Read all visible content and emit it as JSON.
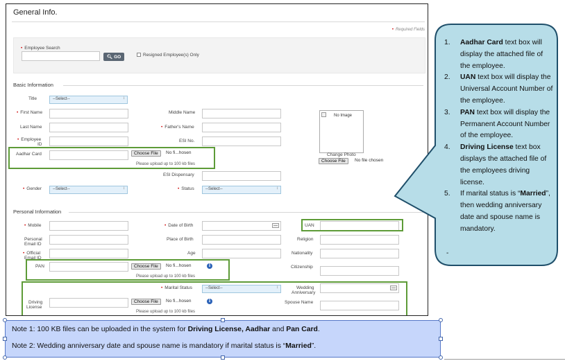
{
  "form": {
    "title": "General Info.",
    "required_note": "Required Fields",
    "search": {
      "employee_search_label": "Employee Search",
      "go_label": "GO",
      "resigned_label": "Resigned Employee(s) Only"
    },
    "basic": {
      "section_title": "Basic Information",
      "title_label": "Title",
      "title_value": "--Select--",
      "first_name_label": "First Name",
      "middle_name_label": "Middle Name",
      "last_name_label": "Last Name",
      "fathers_name_label": "Father's Name",
      "employee_id_label_1": "Employee",
      "employee_id_label_2": "ID",
      "esi_no_label": "ESI No.",
      "aadhar_label": "Aadhar Card",
      "esi_dispensary_label": "ESI Dispensary",
      "gender_label": "Gender",
      "gender_value": "--Select--",
      "status_label": "Status",
      "status_value": "--Select--",
      "no_image_label": "No Image",
      "change_photo_label": "Change Photo",
      "photo_file_text": "No file chosen"
    },
    "personal": {
      "section_title": "Personal Information",
      "mobile_label": "Mobile",
      "dob_label": "Date of Birth",
      "uan_label": "UAN",
      "personal_email_label_1": "Personal",
      "personal_email_label_2": "Email ID",
      "birth_place_label": "Place of Birth",
      "religion_label": "Religion",
      "official_email_label_1": "Official",
      "official_email_label_2": "Email ID",
      "age_label": "Age",
      "nationality_label": "Nationality",
      "pan_label": "PAN",
      "citizenship_label": "Citizenship",
      "marital_status_label": "Marital Status",
      "marital_status_value": "--Select--",
      "wedding_label_1": "Wedding",
      "wedding_label_2": "Anniversary",
      "driving_label_1": "Driving",
      "driving_label_2": "License",
      "spouse_label": "Spouse Name"
    },
    "file_button_label": "Choose File",
    "file_truncated_text": "No fi...hosen",
    "upload_hint": "Please upload up to 100 kb files"
  },
  "callout": {
    "items": [
      {
        "num": "1.",
        "bold": "Aadhar Card",
        "text": " text box will display the attached file of the employee."
      },
      {
        "num": "2.",
        "bold": "UAN",
        "text": " text box will display the Universal Account Number of the employee."
      },
      {
        "num": "3.",
        "bold": "PAN",
        "text": " text box will display the Permanent Account Number of the employee."
      },
      {
        "num": "4.",
        "bold": "Driving License",
        "text": " text box displays the attached file of the employees driving license."
      },
      {
        "num": "5.",
        "pre": "If marital status is “",
        "bold": "Married",
        "text": "”, then wedding anniversary date and spouse name is mandatory."
      }
    ],
    "trailing": "-"
  },
  "notes": {
    "note1_pre": "Note 1: 100 KB files can be uploaded in the system for ",
    "note1_b1": "Driving License, Aadhar",
    "note1_mid": " and ",
    "note1_b2": "Pan Card",
    "note1_post": ".",
    "note2_pre": "Note 2: Wedding anniversary date and spouse name is mandatory if marital status is “",
    "note2_b": "Married",
    "note2_post": "”."
  },
  "colors": {
    "callout_fill": "#b7dde8",
    "callout_border": "#1f4f6a",
    "highlight_green": "#5d9b37",
    "note_fill": "#c6d6fb"
  }
}
